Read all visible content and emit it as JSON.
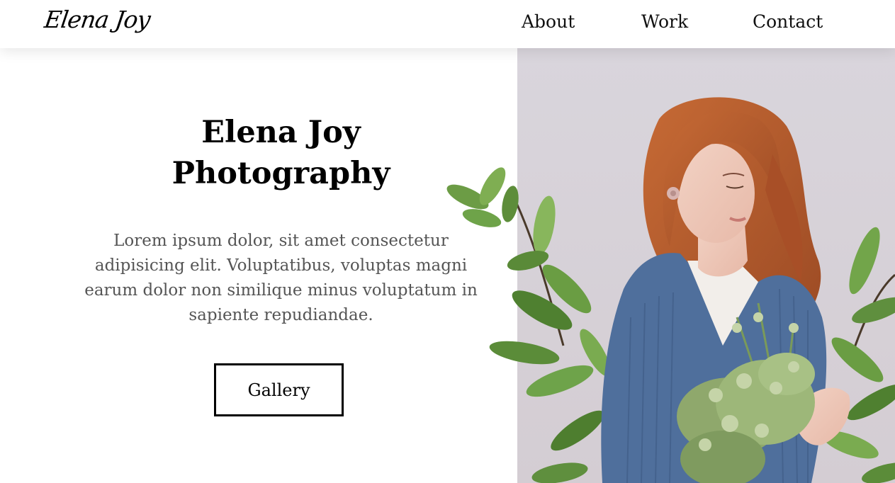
{
  "header": {
    "logo_text": "Elena Joy",
    "nav": {
      "about": "About",
      "work": "Work",
      "contact": "Contact"
    }
  },
  "hero": {
    "title_line1": "Elena Joy",
    "title_line2": "Photography",
    "description": "Lorem ipsum dolor, sit amet consectetur adipisicing elit. Voluptatibus, voluptas magni earum dolor non similique minus voluptatum in sapiente repudiandae.",
    "button_label": "Gallery"
  },
  "colors": {
    "text": "#000000",
    "body_text": "#555555",
    "photo_background": "#dcd7de",
    "sweater": "#4f6f9c",
    "hair": "#b4582b",
    "leaves": "#5f8f3e"
  },
  "icons": {
    "photo": "woman-with-bouquet-photo"
  }
}
